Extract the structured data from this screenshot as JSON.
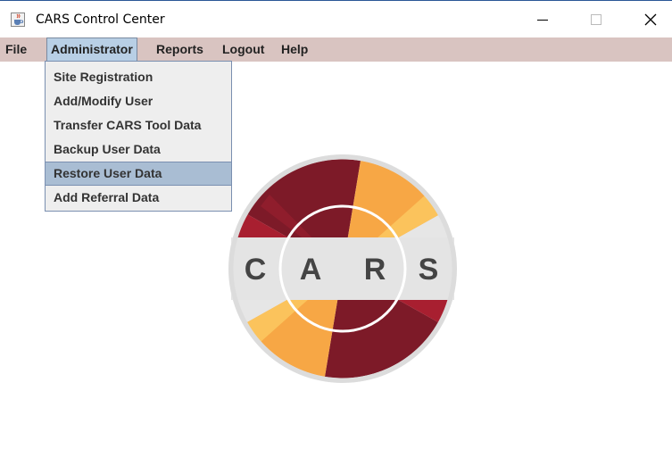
{
  "window": {
    "title": "CARS Control Center",
    "icons": {
      "app": "java-cup-icon",
      "minimize": "minimize-icon",
      "maximize": "maximize-icon",
      "close": "close-icon"
    }
  },
  "menubar": {
    "items": [
      "File",
      "Administrator",
      "Reports",
      "Logout",
      "Help"
    ],
    "active": "Administrator"
  },
  "dropdown": {
    "items": [
      "Site Registration",
      "Add/Modify User",
      "Transfer CARS Tool Data",
      "Backup User Data",
      "Restore User Data",
      "Add Referral Data"
    ],
    "highlighted": "Restore User Data"
  },
  "logo": {
    "letters": [
      "C",
      "A",
      "R",
      "S"
    ],
    "colors": {
      "dark_red": "#7d1a28",
      "red": "#a81f30",
      "orange": "#f7a745",
      "light_orange": "#fbc35c",
      "gray": "#e4e4e4",
      "letter": "#444444"
    }
  }
}
